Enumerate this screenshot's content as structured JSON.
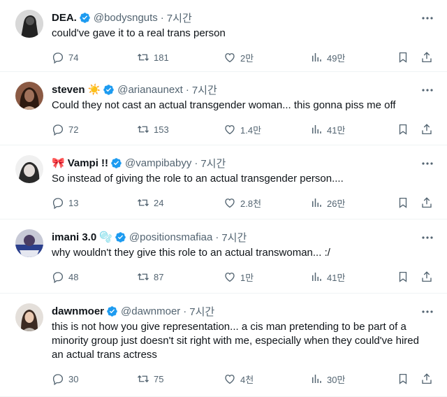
{
  "tweets": [
    {
      "name": "DEA.",
      "emoji": "",
      "handle": "@bodysnguts",
      "time": "7시간",
      "text": "could've gave it to a real trans person",
      "replies": "74",
      "retweets": "181",
      "likes": "2만",
      "views": "49만",
      "avatar_colors": [
        "#222222",
        "#777777"
      ]
    },
    {
      "name": "steven",
      "emoji": "☀️",
      "handle": "@arianaunext",
      "time": "7시간",
      "text": "Could they not cast an actual transgender woman... this gonna piss me off",
      "replies": "72",
      "retweets": "153",
      "likes": "1.4만",
      "views": "41만",
      "avatar_colors": [
        "#3a2418",
        "#a0715a"
      ]
    },
    {
      "name": "Vampi !!",
      "emoji": "🎀",
      "handle": "@vampibabyy",
      "time": "7시간",
      "text": "So instead of giving the role to an actual transgender person....",
      "replies": "13",
      "retweets": "24",
      "likes": "2.8천",
      "views": "26만",
      "avatar_colors": [
        "#e9e9e9",
        "#2a2a2a"
      ]
    },
    {
      "name": "imani 3.0",
      "emoji": "🫧",
      "handle": "@positionsmafiaa",
      "time": "7시간",
      "text": "why wouldn't they give this role to an actual transwoman... :/",
      "replies": "48",
      "retweets": "87",
      "likes": "1만",
      "views": "41만",
      "avatar_colors": [
        "#2b3f8c",
        "#c7c9d6"
      ]
    },
    {
      "name": "dawnmoer",
      "emoji": "",
      "handle": "@dawnmoer",
      "time": "7시간",
      "text": "this is not how you give representation... a cis man pretending to be part of a minority group just doesn't sit right with me, especially when they could've hired an actual trans actress",
      "replies": "30",
      "retweets": "75",
      "likes": "4천",
      "views": "30만",
      "avatar_colors": [
        "#d8d2cc",
        "#3b2a22"
      ]
    }
  ],
  "colors": {
    "verified": "#1d9bf0",
    "muted": "#536471",
    "text": "#0f1419",
    "divider": "#eff3f4"
  },
  "icons": [
    "more-icon",
    "reply-icon",
    "retweet-icon",
    "like-icon",
    "views-icon",
    "bookmark-icon",
    "share-icon",
    "verified-badge-icon"
  ]
}
